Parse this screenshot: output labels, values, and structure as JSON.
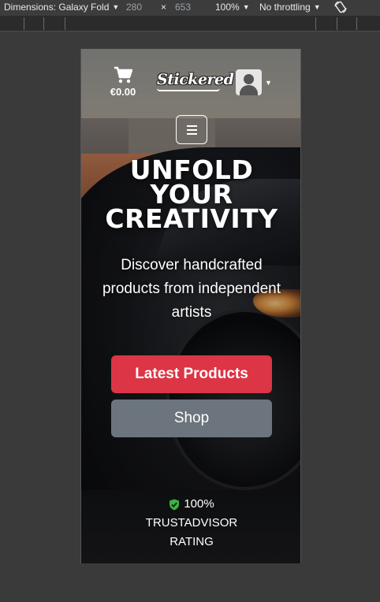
{
  "devtools": {
    "dimensions_label": "Dimensions: Galaxy Fold",
    "width": "280",
    "times": "×",
    "height": "653",
    "zoom": "100%",
    "throttling": "No throttling",
    "caret": "▼",
    "rotate_icon": "rotate-icon"
  },
  "header": {
    "cart_total": "€0.00",
    "logo_text": "Stickered",
    "avatar_caret": "▼"
  },
  "hero": {
    "title_line1": "UNFOLD",
    "title_line2": "YOUR",
    "title_line3": "CREATIVITY",
    "subtitle": "Discover handcrafted products from independent artists",
    "primary_button": "Latest Products",
    "secondary_button": "Shop"
  },
  "trust": {
    "percent": "100%",
    "line2": "TRUSTADVISOR",
    "line3": "RATING"
  },
  "colors": {
    "primary": "#dc3545",
    "secondary": "#6c757d",
    "shield": "#3cb043"
  }
}
